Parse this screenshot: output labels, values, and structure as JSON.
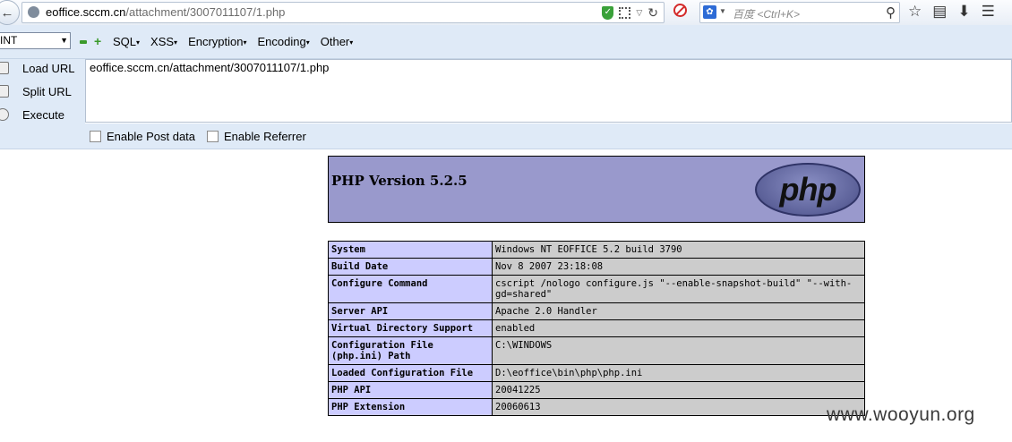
{
  "browser": {
    "url_host": "eoffice.sccm.cn",
    "url_path": "/attachment/3007011107/1.php",
    "search_placeholder": "百度 <Ctrl+K>"
  },
  "hackbar": {
    "encoding_select": "INT",
    "menu": [
      "SQL",
      "XSS",
      "Encryption",
      "Encoding",
      "Other"
    ],
    "buttons": {
      "load": "Load URL",
      "split": "Split URL",
      "execute": "Execute"
    },
    "url_value": "eoffice.sccm.cn/attachment/3007011107/1.php",
    "options": {
      "post": "Enable Post data",
      "referrer": "Enable Referrer"
    }
  },
  "phpinfo": {
    "version": "PHP Version 5.2.5",
    "logo_text": "php",
    "rows": [
      {
        "key": "System",
        "value": "Windows NT EOFFICE 5.2 build 3790"
      },
      {
        "key": "Build Date",
        "value": "Nov 8 2007 23:18:08"
      },
      {
        "key": "Configure Command",
        "value": "cscript /nologo configure.js \"--enable-snapshot-build\" \"--with-gd=shared\""
      },
      {
        "key": "Server API",
        "value": "Apache 2.0 Handler"
      },
      {
        "key": "Virtual Directory Support",
        "value": "enabled"
      },
      {
        "key": "Configuration File (php.ini) Path",
        "value": "C:\\WINDOWS"
      },
      {
        "key": "Loaded Configuration File",
        "value": "D:\\eoffice\\bin\\php\\php.ini"
      },
      {
        "key": "PHP API",
        "value": "20041225"
      },
      {
        "key": "PHP Extension",
        "value": "20060613"
      }
    ]
  },
  "watermark": "www.wooyun.org"
}
